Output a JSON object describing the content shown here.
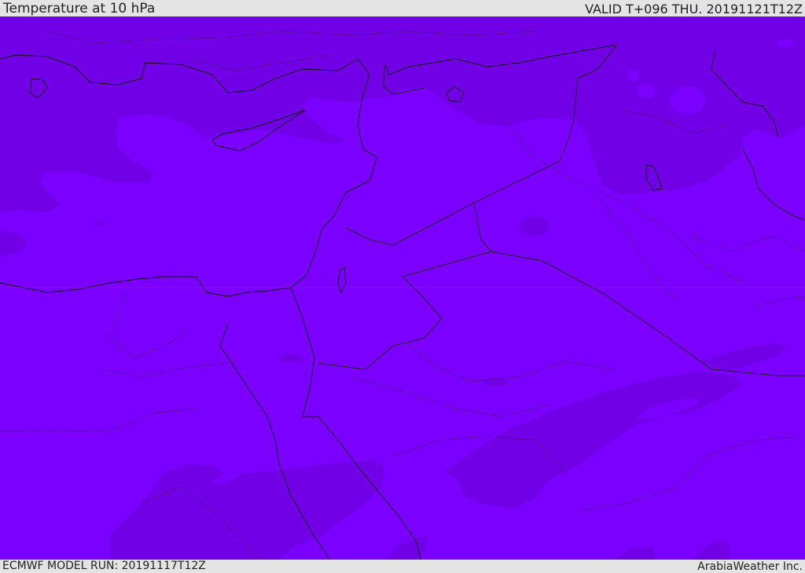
{
  "header": {
    "title": "Temperature at 10 hPa",
    "valid": "VALID T+096 THU. 20191121T12Z"
  },
  "footer": {
    "model_run": "ECMWF MODEL RUN: 20191117T12Z",
    "credit": "ArabiaWeather Inc."
  },
  "map": {
    "base_color": "#7c00ff",
    "cold_color": "#7200e6",
    "coast_color": "#111111",
    "border_color": "#222222"
  }
}
